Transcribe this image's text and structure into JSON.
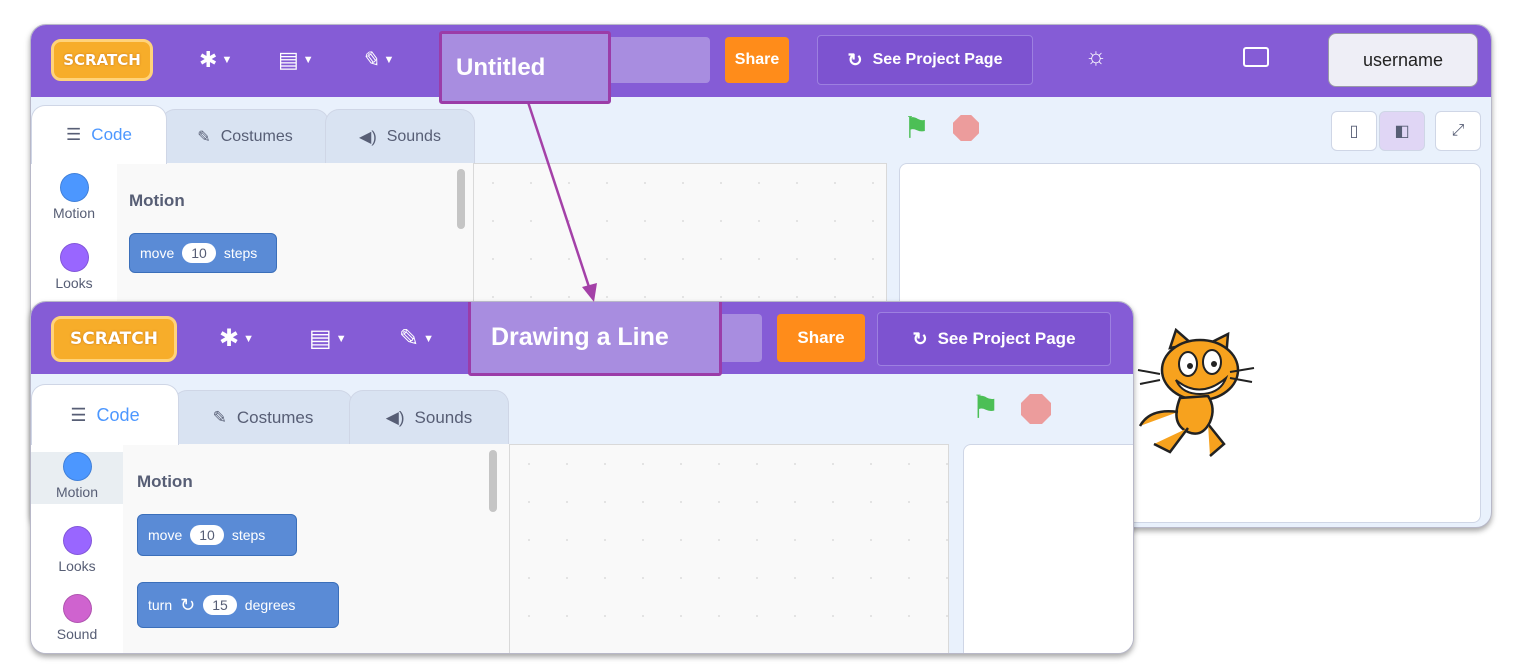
{
  "top_window": {
    "logo_text": "SCRATCH",
    "project_title": "Untitled",
    "share_label": "Share",
    "see_project_label": "See Project Page",
    "user_label": "username",
    "tabs": [
      {
        "label": "Code"
      },
      {
        "label": "Costumes"
      },
      {
        "label": "Sounds"
      }
    ],
    "categories": [
      {
        "label": "Motion",
        "color": "#4c97ff"
      },
      {
        "label": "Looks",
        "color": "#9966ff"
      }
    ],
    "section_title": "Motion",
    "move_block": {
      "prefix": "move",
      "value": "10",
      "suffix": "steps"
    }
  },
  "bottom_window": {
    "logo_text": "SCRATCH",
    "project_title": "Drawing a Line",
    "share_label": "Share",
    "see_project_label": "See Project Page",
    "tabs": [
      {
        "label": "Code"
      },
      {
        "label": "Costumes"
      },
      {
        "label": "Sounds"
      }
    ],
    "categories": [
      {
        "label": "Motion",
        "color": "#4c97ff"
      },
      {
        "label": "Looks",
        "color": "#9966ff"
      },
      {
        "label": "Sound",
        "color": "#cf63cf"
      }
    ],
    "section_title": "Motion",
    "move_block": {
      "prefix": "move",
      "value": "10",
      "suffix": "steps"
    },
    "turn_block": {
      "prefix": "turn",
      "value": "15",
      "suffix": "degrees"
    }
  },
  "colors": {
    "menubar": "#855cd6",
    "share": "#ff8c1a",
    "highlight": "#9b3ca8",
    "arrow": "#a441a8"
  }
}
